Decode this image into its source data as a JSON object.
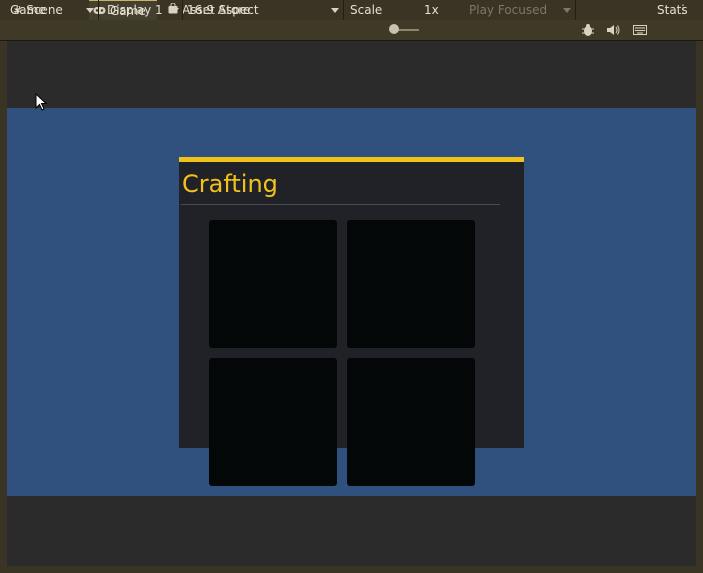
{
  "tabs": [
    {
      "label": "Scene",
      "icon": "grid-icon"
    },
    {
      "label": "Game",
      "icon": "gamepad-icon"
    },
    {
      "label": "Asset Store",
      "icon": "bag-icon"
    }
  ],
  "toolbar": {
    "view_mode": "Game",
    "display": "Display 1",
    "aspect": "16:9 Aspect",
    "scale_label": "Scale",
    "scale_value": "1x",
    "play_mode": "Play Focused",
    "stats_label": "Stats"
  },
  "game_ui": {
    "panel_title": "Crafting",
    "slots": [
      {
        "name": "crafting-slot-1"
      },
      {
        "name": "crafting-slot-2"
      },
      {
        "name": "crafting-slot-3"
      },
      {
        "name": "crafting-slot-4"
      }
    ],
    "colors": {
      "accent": "#f2c21b",
      "panel": "#212227",
      "game_background": "#30507e",
      "slot": "#040708"
    }
  }
}
